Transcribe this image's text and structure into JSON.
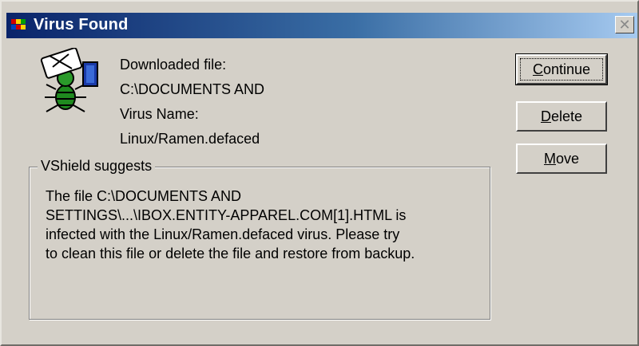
{
  "window": {
    "title": "Virus Found"
  },
  "icons": {
    "title": "virus-shield-icon",
    "virus": "virus-bug-icon",
    "close": "close-icon"
  },
  "info": {
    "downloaded_label": "Downloaded file:",
    "downloaded_path": "C:\\DOCUMENTS AND",
    "virus_label": "Virus Name:",
    "virus_name": "Linux/Ramen.defaced"
  },
  "buttons": [
    {
      "label": "Continue",
      "mnemonic": "C",
      "default": true
    },
    {
      "label": "Delete",
      "mnemonic": "D",
      "default": false
    },
    {
      "label": "Move",
      "mnemonic": "M",
      "default": false
    }
  ],
  "suggestion": {
    "label": "VShield suggests",
    "lines": [
      "The file C:\\DOCUMENTS AND",
      "SETTINGS\\...\\IBOX.ENTITY-APPAREL.COM[1].HTML is",
      "infected with the Linux/Ramen.defaced virus. Please try",
      "to clean this file or delete the file and restore from backup."
    ]
  }
}
